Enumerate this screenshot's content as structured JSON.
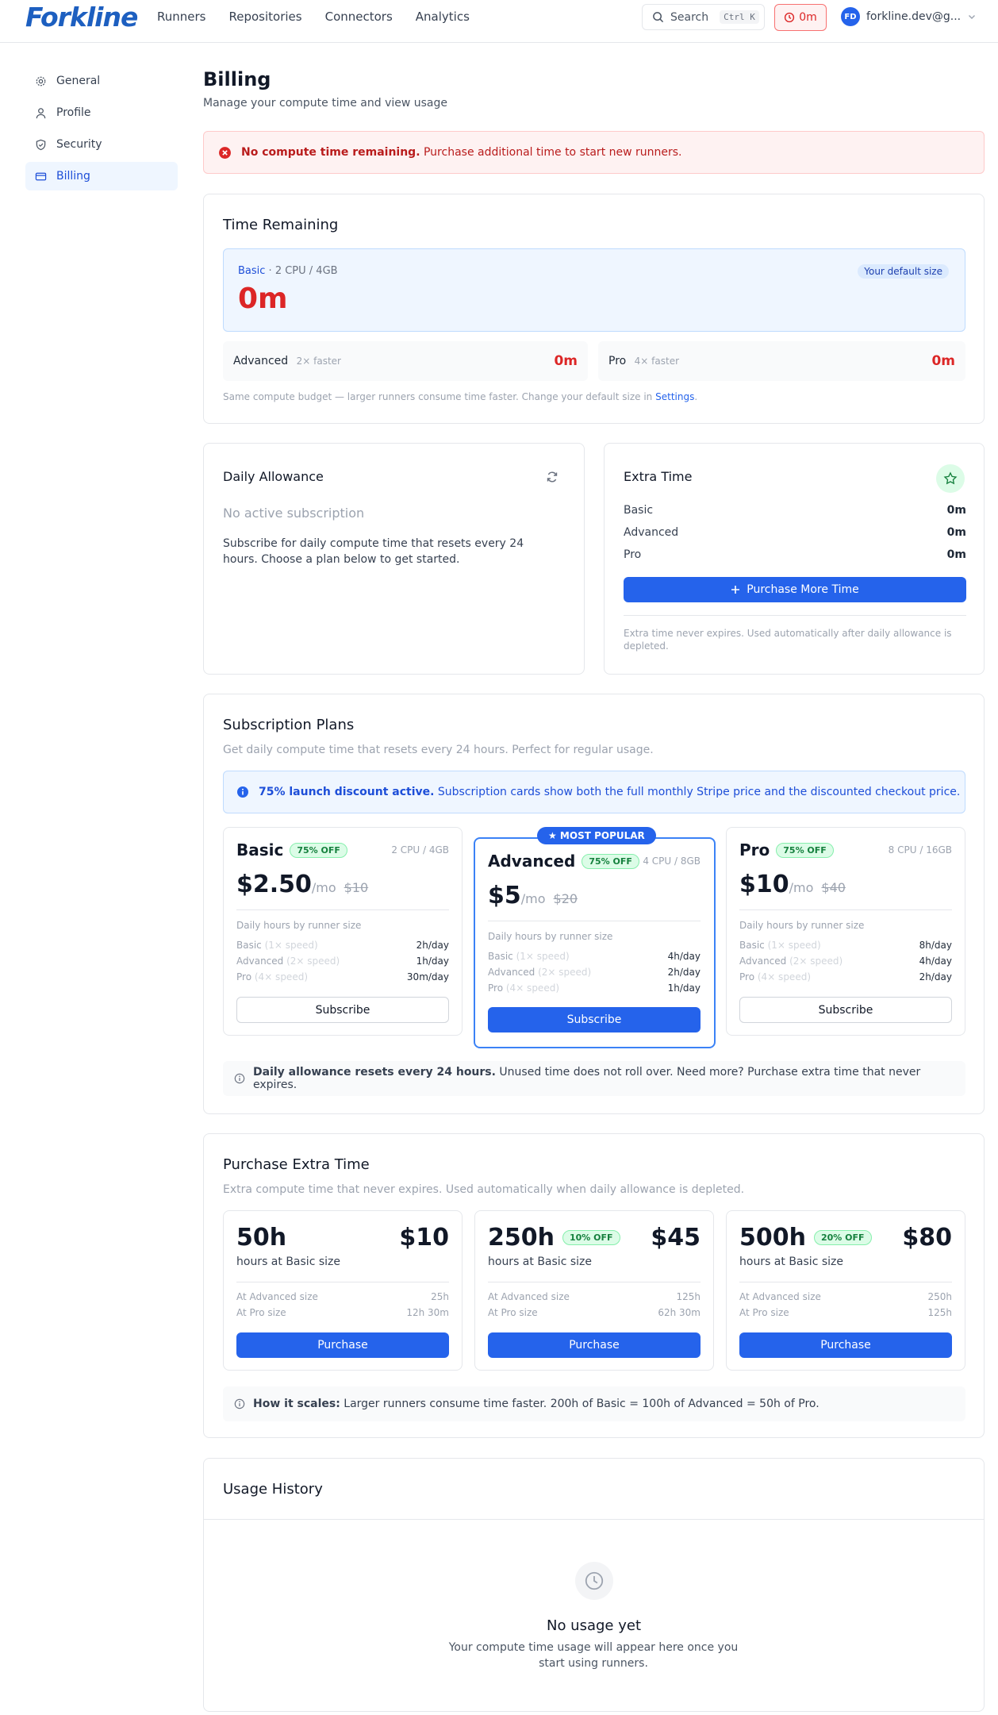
{
  "app": {
    "logo": "Forkline"
  },
  "nav": {
    "items": [
      "Runners",
      "Repositories",
      "Connectors",
      "Analytics"
    ]
  },
  "search": {
    "label": "Search",
    "shortcut": "Ctrl K"
  },
  "time_badge": "0m",
  "user": {
    "initials": "FD",
    "email": "forkline.dev@g..."
  },
  "sidebar": {
    "items": [
      {
        "label": "General",
        "icon": "gear-icon"
      },
      {
        "label": "Profile",
        "icon": "user-icon"
      },
      {
        "label": "Security",
        "icon": "shield-icon"
      },
      {
        "label": "Billing",
        "icon": "credit-card-icon",
        "active": true
      }
    ]
  },
  "page": {
    "title": "Billing",
    "subtitle": "Manage your compute time and view usage"
  },
  "alert": {
    "bold": "No compute time remaining.",
    "text": " Purchase additional time to start new runners."
  },
  "time_remaining": {
    "title": "Time Remaining",
    "basic": {
      "name": "Basic",
      "spec": " · 2 CPU / 4GB",
      "badge": "Your default size",
      "value": "0m"
    },
    "advanced": {
      "name": "Advanced",
      "speed": "2× faster",
      "value": "0m"
    },
    "pro": {
      "name": "Pro",
      "speed": "4× faster",
      "value": "0m"
    },
    "note": "Same compute budget — larger runners consume time faster. Change your default size in ",
    "note_link": "Settings",
    "note_end": "."
  },
  "daily": {
    "title": "Daily Allowance",
    "status": "No active subscription",
    "text": "Subscribe for daily compute time that resets every 24 hours. Choose a plan below to get started."
  },
  "extra": {
    "title": "Extra Time",
    "rows": [
      {
        "label": "Basic",
        "value": "0m"
      },
      {
        "label": "Advanced",
        "value": "0m"
      },
      {
        "label": "Pro",
        "value": "0m"
      }
    ],
    "button": "Purchase More Time",
    "note": "Extra time never expires. Used automatically after daily allowance is depleted."
  },
  "subscriptions": {
    "title": "Subscription Plans",
    "subtitle": "Get daily compute time that resets every 24 hours. Perfect for regular usage.",
    "banner_bold": "75% launch discount active.",
    "banner_text": " Subscription cards show both the full monthly Stripe price and the discounted checkout price.",
    "popular": "★ MOST POPULAR",
    "hours_label": "Daily hours by runner size",
    "plans": [
      {
        "name": "Basic",
        "discount": "75% OFF",
        "spec": "2 CPU / 4GB",
        "price": "$2.50",
        "per": "/mo",
        "old": "$10",
        "rows": [
          {
            "label": "Basic",
            "speed": "(1× speed)",
            "value": "2h/day"
          },
          {
            "label": "Advanced",
            "speed": "(2× speed)",
            "value": "1h/day"
          },
          {
            "label": "Pro",
            "speed": "(4× speed)",
            "value": "30m/day"
          }
        ],
        "button": "Subscribe"
      },
      {
        "name": "Advanced",
        "discount": "75% OFF",
        "spec": "4 CPU / 8GB",
        "price": "$5",
        "per": "/mo",
        "old": "$20",
        "rows": [
          {
            "label": "Basic",
            "speed": "(1× speed)",
            "value": "4h/day"
          },
          {
            "label": "Advanced",
            "speed": "(2× speed)",
            "value": "2h/day"
          },
          {
            "label": "Pro",
            "speed": "(4× speed)",
            "value": "1h/day"
          }
        ],
        "button": "Subscribe"
      },
      {
        "name": "Pro",
        "discount": "75% OFF",
        "spec": "8 CPU / 16GB",
        "price": "$10",
        "per": "/mo",
        "old": "$40",
        "rows": [
          {
            "label": "Basic",
            "speed": "(1× speed)",
            "value": "8h/day"
          },
          {
            "label": "Advanced",
            "speed": "(2× speed)",
            "value": "4h/day"
          },
          {
            "label": "Pro",
            "speed": "(4× speed)",
            "value": "2h/day"
          }
        ],
        "button": "Subscribe"
      }
    ],
    "footer_bold": "Daily allowance resets every 24 hours.",
    "footer_text": " Unused time does not roll over. Need more? Purchase extra time that never expires."
  },
  "purchase": {
    "title": "Purchase Extra Time",
    "subtitle": "Extra compute time that never expires. Used automatically when daily allowance is depleted.",
    "packs": [
      {
        "hours": "50h",
        "discount": "",
        "price": "$10",
        "desc": "hours at Basic size",
        "adv_label": "At Advanced size",
        "adv": "25h",
        "pro_label": "At Pro size",
        "pro": "12h 30m",
        "button": "Purchase"
      },
      {
        "hours": "250h",
        "discount": "10% OFF",
        "price": "$45",
        "desc": "hours at Basic size",
        "adv_label": "At Advanced size",
        "adv": "125h",
        "pro_label": "At Pro size",
        "pro": "62h 30m",
        "button": "Purchase"
      },
      {
        "hours": "500h",
        "discount": "20% OFF",
        "price": "$80",
        "desc": "hours at Basic size",
        "adv_label": "At Advanced size",
        "adv": "250h",
        "pro_label": "At Pro size",
        "pro": "125h",
        "button": "Purchase"
      }
    ],
    "footer_bold": "How it scales:",
    "footer_text": " Larger runners consume time faster. 200h of Basic = 100h of Advanced = 50h of Pro."
  },
  "usage": {
    "title": "Usage History",
    "empty_title": "No usage yet",
    "empty_text": "Your compute time usage will appear here once you start using runners."
  },
  "colors": {
    "accent": "#2563eb",
    "danger": "#dc2626",
    "success": "#15803d"
  }
}
